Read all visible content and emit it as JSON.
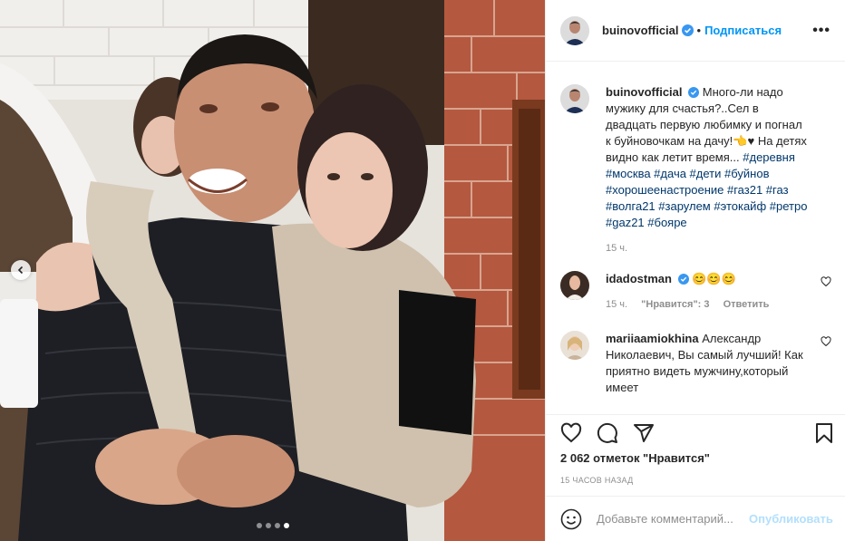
{
  "post": {
    "username": "buinovofficial",
    "follow_label": "Подписаться",
    "separator": "•",
    "more_label": "•••"
  },
  "caption": {
    "username": "buinovofficial",
    "text": "Много-ли надо мужику для счастья?..Сел в двадцать первую любимку и погнал к буйновочкам на дачу!👈♥ На детях видно как летит время...",
    "hashtags": "#деревня #москва #дача #дети #буйнов #хорошеенастроение #газ21 #газ #волга21 #зарулем #этокайф #ретро #gaz21 #бояре",
    "time": "15 ч."
  },
  "comments": [
    {
      "username": "idadostman",
      "text": "😊😊😊",
      "time": "15 ч.",
      "likes": "\"Нравится\": 3",
      "reply": "Ответить"
    },
    {
      "username": "mariiaamiokhina",
      "text": "Александр Николаевич, Вы самый лучший! Как приятно видеть мужчину,который имеет"
    }
  ],
  "stats": {
    "likes": "2 062 отметок \"Нравится\"",
    "time": "15 часов назад"
  },
  "add_comment": {
    "placeholder": "Добавьте комментарий...",
    "post_label": "Опубликовать"
  },
  "carousel": {
    "count": 4,
    "active": 4
  },
  "icons": [
    "chevron-left-icon",
    "verified-icon",
    "more-icon",
    "heart-icon",
    "comment-icon",
    "share-icon",
    "bookmark-icon",
    "emoji-icon"
  ],
  "colors": {
    "accent": "#0095f6",
    "hashtag": "#00376b",
    "muted": "#8e8e8e",
    "post_disabled": "#b2dffc"
  }
}
